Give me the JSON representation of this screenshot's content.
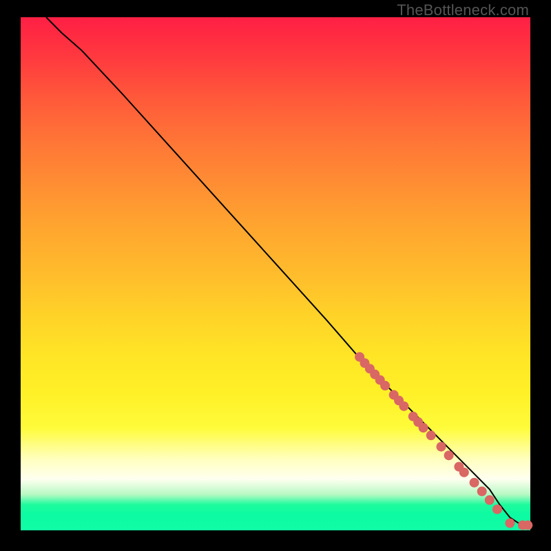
{
  "watermark": "TheBottleneck.com",
  "colors": {
    "line": "#000000",
    "marker": "#d96764",
    "frame": "#000000"
  },
  "chart_data": {
    "type": "line",
    "title": "",
    "xlabel": "",
    "ylabel": "",
    "xlim": [
      0,
      100
    ],
    "ylim": [
      0,
      100
    ],
    "grid": false,
    "legend": false,
    "series": [
      {
        "name": "curve",
        "x": [
          5,
          8,
          12,
          20,
          30,
          40,
          50,
          60,
          67,
          70,
          73,
          75,
          77,
          78.5,
          80,
          82,
          84,
          86,
          88,
          90,
          92,
          94,
          96,
          98,
          100
        ],
        "y": [
          100,
          97,
          93.5,
          85,
          74,
          63,
          52,
          41,
          33,
          30,
          27,
          25,
          23,
          21.5,
          20,
          18,
          16,
          14,
          12,
          10,
          8,
          5,
          2.5,
          1.2,
          1
        ],
        "stroke_width": 2
      }
    ],
    "markers": [
      {
        "x": 66.5,
        "y": 33.8,
        "r": 7
      },
      {
        "x": 67.5,
        "y": 32.6,
        "r": 7
      },
      {
        "x": 68.5,
        "y": 31.5,
        "r": 7
      },
      {
        "x": 69.5,
        "y": 30.4,
        "r": 7
      },
      {
        "x": 70.5,
        "y": 29.3,
        "r": 7
      },
      {
        "x": 71.5,
        "y": 28.2,
        "r": 7
      },
      {
        "x": 73.2,
        "y": 26.4,
        "r": 7
      },
      {
        "x": 74.2,
        "y": 25.3,
        "r": 7
      },
      {
        "x": 75.2,
        "y": 24.2,
        "r": 7
      },
      {
        "x": 77.0,
        "y": 22.2,
        "r": 7
      },
      {
        "x": 78.0,
        "y": 21.1,
        "r": 7
      },
      {
        "x": 79.0,
        "y": 20.0,
        "r": 7
      },
      {
        "x": 80.5,
        "y": 18.5,
        "r": 7
      },
      {
        "x": 82.5,
        "y": 16.3,
        "r": 7
      },
      {
        "x": 84.0,
        "y": 14.6,
        "r": 7
      },
      {
        "x": 86.0,
        "y": 12.4,
        "r": 7
      },
      {
        "x": 87.0,
        "y": 11.3,
        "r": 7
      },
      {
        "x": 89.0,
        "y": 9.3,
        "r": 7
      },
      {
        "x": 90.5,
        "y": 7.6,
        "r": 7
      },
      {
        "x": 92.0,
        "y": 5.9,
        "r": 7
      },
      {
        "x": 93.5,
        "y": 4.1,
        "r": 7
      },
      {
        "x": 96.0,
        "y": 1.4,
        "r": 7
      },
      {
        "x": 98.5,
        "y": 1.0,
        "r": 7
      },
      {
        "x": 99.5,
        "y": 1.0,
        "r": 7
      }
    ]
  }
}
